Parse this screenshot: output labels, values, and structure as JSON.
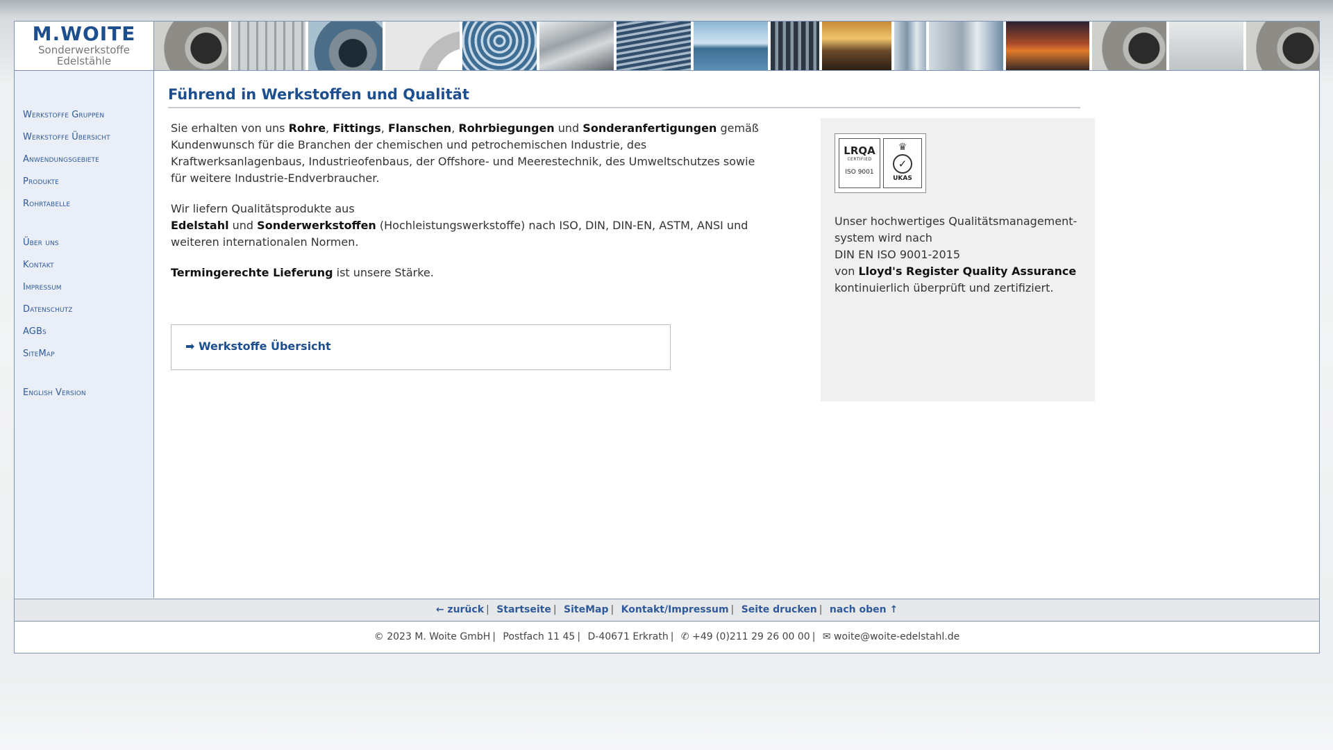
{
  "header": {
    "logo_mark": "M.WOITE",
    "logo_line1": "Sonderwerkstoffe",
    "logo_line2": "Edelstähle",
    "image_strip": [
      "steel-pipe-end",
      "pipe-bundle",
      "pipe-opening",
      "pipe-bend",
      "pipe-stack",
      "stainless-pipes",
      "oil-tanks",
      "offshore-platform",
      "refinery",
      "pipeline-sunset",
      "industrial-plant",
      "storage-tank",
      "industrial-fire",
      "steel-pipe-end",
      "pipe-bundle",
      "pipe-opening"
    ]
  },
  "sidebar": {
    "group1": [
      "Werkstoffe Gruppen",
      "Werkstoffe Übersicht",
      "Anwendungsgebiete",
      "Produkte",
      "Rohrtabelle"
    ],
    "group2": [
      "Über uns",
      "Kontakt",
      "Impressum",
      "Datenschutz",
      "AGBs",
      "SiteMap"
    ],
    "group3": [
      "English Version"
    ]
  },
  "main": {
    "title": "Führend in Werkstoffen und Qualität",
    "p1": {
      "t1": "Sie erhalten von uns ",
      "b1": "Rohre",
      "t2": ", ",
      "b2": "Fittings",
      "t3": ", ",
      "b3": "Flanschen",
      "t4": ", ",
      "b4": "Rohrbiegungen",
      "t5": " und ",
      "b5": "Sonderanfertigungen",
      "t6": " gemäß Kundenwunsch für die Branchen der chemischen und petrochemischen Industrie, des Kraftwerksanlagenbaus, Industrieofenbaus, der Offshore- und Meerestechnik, des Umweltschutzes sowie für weitere Industrie-Endverbraucher."
    },
    "p2": {
      "t1": "Wir liefern Qualitätsprodukte aus",
      "b1": "Edelstahl",
      "t2": " und ",
      "b2": "Sonderwerkstoffen",
      "t3": " (Hochleistungswerkstoffe) nach ISO, DIN, DIN-EN, ASTM, ANSI und weiteren internationalen Normen."
    },
    "p3": {
      "b1": "Termingerechte Lieferung",
      "t1": " ist unsere Stärke."
    },
    "link_box": "➡ Werkstoffe Übersicht"
  },
  "cert": {
    "badge_lrqa": "LRQA",
    "badge_certified": "CERTIFIED",
    "badge_iso": "ISO 9001",
    "badge_ukas": "UKAS",
    "line1": "Unser hochwertiges Qualitätsmanagement-",
    "line2": "system wird nach",
    "line3": "DIN EN ISO 9001-2015",
    "line4_pre": "von ",
    "line4_bold": "Lloyd's Register Quality Assurance",
    "line5": "kontinuierlich überprüft und zertifiziert."
  },
  "footer": {
    "nav": [
      "← zurück",
      "Startseite",
      "SiteMap",
      "Kontakt/Impressum",
      "Seite drucken",
      "nach oben ↑"
    ],
    "separator": "|",
    "info": [
      "© 2023 M. Woite GmbH",
      "Postfach 11 45",
      "D-40671 Erkrath",
      "✆ +49 (0)211 29 26 00 00",
      "✉ woite@woite-edelstahl.de"
    ]
  },
  "colors": {
    "accent": "#1d4e8e",
    "nav_link": "#2f5a9a",
    "sidebar_bg": "#e9eef7",
    "border": "#7d93b3",
    "cert_bg": "#f0f0f0"
  }
}
